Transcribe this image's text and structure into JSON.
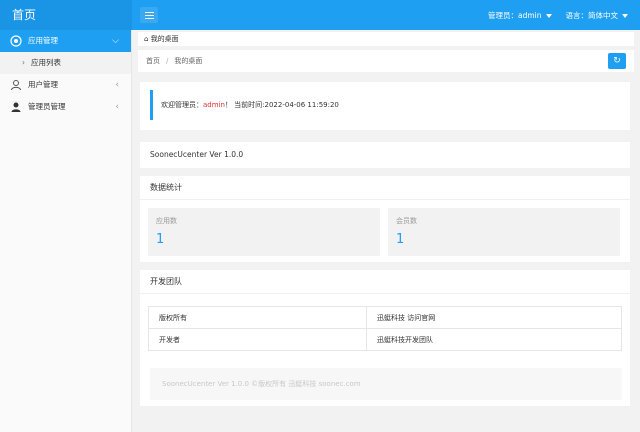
{
  "header": {
    "brand": "首页",
    "admin_label": "管理员：admin",
    "language_label": "语言：简体中文"
  },
  "sidebar": {
    "items": [
      {
        "label": "应用管理",
        "icon": "apps-icon",
        "active": true
      },
      {
        "label": "应用列表",
        "sub": true
      },
      {
        "label": "用户管理",
        "icon": "user-icon"
      },
      {
        "label": "管理员管理",
        "icon": "admin-icon"
      }
    ]
  },
  "tabs": {
    "home_tab": "我的桌面"
  },
  "breadcrumb": {
    "home": "首页",
    "separator": "/",
    "current": "我的桌面"
  },
  "welcome": {
    "prefix": "欢迎管理员：",
    "username": "admin",
    "suffix": "！ 当前时间:2022-04-06 11:59:20"
  },
  "version": {
    "text": "SoonecUcenter Ver 1.0.0"
  },
  "stats": {
    "title": "数据统计",
    "apps_label": "应用数",
    "apps_value": "1",
    "members_label": "会员数",
    "members_value": "1"
  },
  "team": {
    "title": "开发团队",
    "rows": [
      {
        "label": "版权所有",
        "value": "迅蜓科技 访问官网"
      },
      {
        "label": "开发者",
        "value": "迅蜓科技开发团队"
      }
    ]
  },
  "footer": {
    "text": "SoonecUcenter Ver 1.0.0 ©版权所有 迅蜓科技 soonec.com"
  },
  "colors": {
    "accent": "#1e9ff2",
    "highlight_red": "#e03131"
  }
}
